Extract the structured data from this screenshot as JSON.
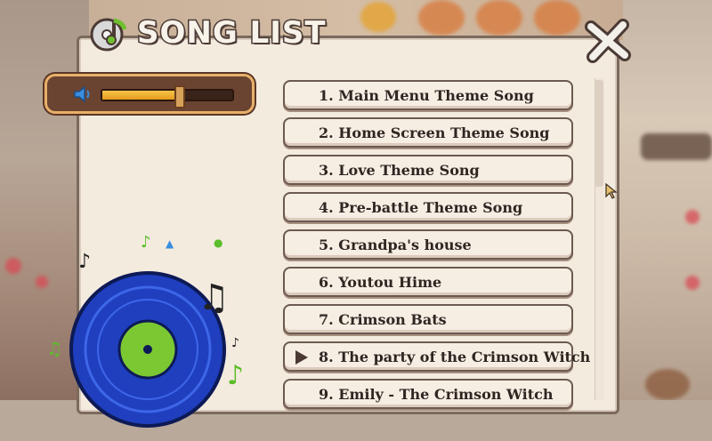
{
  "title": "SONG LIST",
  "volume": {
    "level": 0.58,
    "icon": "speaker-icon"
  },
  "colors": {
    "panel_bg": "#f4ebdf",
    "volume_fill": "#e59a1d",
    "record_blue": "#1f3fbf",
    "record_green": "#7cc832"
  },
  "songs": [
    {
      "label": "1. Main Menu Theme Song"
    },
    {
      "label": "2. Home Screen Theme Song"
    },
    {
      "label": "3. Love Theme Song"
    },
    {
      "label": "4. Pre-battle Theme Song"
    },
    {
      "label": "5. Grandpa's house"
    },
    {
      "label": "6. Youtou Hime"
    },
    {
      "label": "7. Crimson Bats"
    },
    {
      "label": "8. The party of the Crimson Witch",
      "playing": true
    },
    {
      "label": "9. Emily - The Crimson Witch"
    }
  ]
}
